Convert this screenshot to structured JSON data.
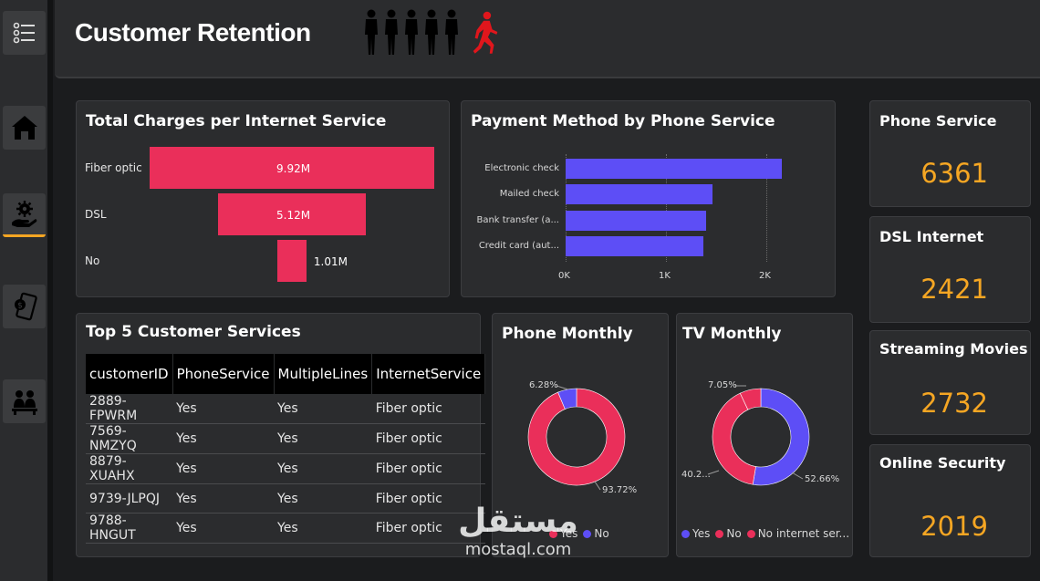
{
  "header": {
    "title": "Customer Retention"
  },
  "sidebar": {
    "items": [
      {
        "name": "menu",
        "icon": "list-menu-icon"
      },
      {
        "name": "home",
        "icon": "home-icon"
      },
      {
        "name": "services",
        "icon": "hand-gear-icon",
        "active": true
      },
      {
        "name": "payments",
        "icon": "phone-payment-icon"
      },
      {
        "name": "customers",
        "icon": "group-users-icon"
      }
    ]
  },
  "colors": {
    "pink": "#ea2f5a",
    "purple": "#5d4ef6",
    "orange": "#f5a623",
    "card": "#2b2c2e"
  },
  "total_charges": {
    "title": "Total Charges per Internet Service",
    "chart_data": {
      "type": "bar",
      "subtype": "funnel",
      "categories": [
        "Fiber optic",
        "DSL",
        "No"
      ],
      "values": [
        9.92,
        5.12,
        1.01
      ],
      "labels": [
        "9.92M",
        "5.12M",
        "1.01M"
      ],
      "unit": "M"
    }
  },
  "payment_method": {
    "title": "Payment Method by Phone Service",
    "chart_data": {
      "type": "bar",
      "orientation": "horizontal",
      "categories": [
        "Electronic check",
        "Mailed check",
        "Bank transfer (a...",
        "Credit card (aut..."
      ],
      "values": [
        2150,
        1460,
        1400,
        1370
      ],
      "xticks": [
        "0K",
        "1K",
        "2K"
      ],
      "xlim": [
        0,
        2300
      ]
    }
  },
  "top_services": {
    "title": "Top 5 Customer Services",
    "columns": [
      "customerID",
      "PhoneService",
      "MultipleLines",
      "InternetService"
    ],
    "rows": [
      [
        "2889-FPWRM",
        "Yes",
        "Yes",
        "Fiber optic"
      ],
      [
        "7569-NMZYQ",
        "Yes",
        "Yes",
        "Fiber optic"
      ],
      [
        "8879-XUAHX",
        "Yes",
        "Yes",
        "Fiber optic"
      ],
      [
        "9739-JLPQJ",
        "Yes",
        "Yes",
        "Fiber optic"
      ],
      [
        "9788-HNGUT",
        "Yes",
        "Yes",
        "Fiber optic"
      ]
    ]
  },
  "phone_monthly": {
    "title": "Phone Monthly",
    "chart_data": {
      "type": "pie",
      "donut": true,
      "categories": [
        "Yes",
        "No"
      ],
      "values": [
        93.72,
        6.28
      ],
      "labels": [
        "93.72%",
        "6.28%"
      ]
    },
    "legend": [
      "Yes",
      "No"
    ]
  },
  "tv_monthly": {
    "title": "TV Monthly",
    "chart_data": {
      "type": "pie",
      "donut": true,
      "categories": [
        "Yes",
        "No",
        "No internet ser..."
      ],
      "values": [
        52.66,
        40.29,
        7.05
      ],
      "labels": [
        "52.66%",
        "40.2...",
        "7.05%"
      ]
    },
    "legend": [
      "Yes",
      "No",
      "No internet ser..."
    ]
  },
  "kpis": [
    {
      "title": "Phone Service",
      "value": "6361"
    },
    {
      "title": "DSL Internet",
      "value": "2421"
    },
    {
      "title": "Streaming Movies",
      "value": "2732"
    },
    {
      "title": "Online Security",
      "value": "2019"
    }
  ],
  "watermark": {
    "arabic": "مستقل",
    "latin": "mostaql.com"
  }
}
